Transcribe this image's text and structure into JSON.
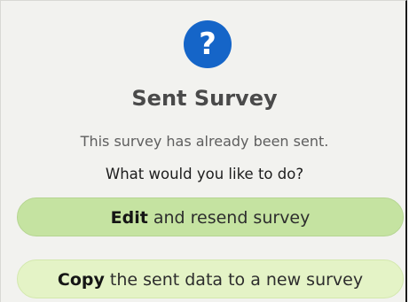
{
  "dialog": {
    "icon": "question-icon",
    "icon_glyph": "?",
    "icon_color": "#1565c8",
    "title": "Sent Survey",
    "message": "This survey has already been sent.",
    "question": "What would you like to do?"
  },
  "options": [
    {
      "bold": "Edit",
      "rest": " and resend survey",
      "color": "#c5e3a1"
    },
    {
      "bold": "Copy",
      "rest": " the sent data to a new survey",
      "color": "#e4f3c6"
    }
  ]
}
